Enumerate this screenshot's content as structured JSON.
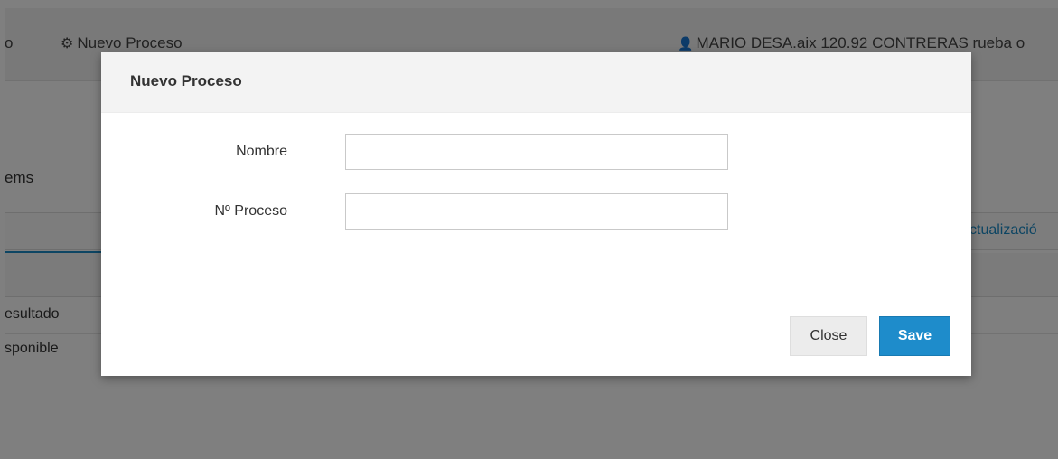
{
  "background": {
    "breadcrumb_prev": "o",
    "breadcrumb_current": "Nuevo Proceso",
    "user_text": "MARIO DESA.aix 120.92 CONTRERAS rueba o",
    "items_title": "ems",
    "tab_label": "ctualizació",
    "row1": "esultado",
    "row2": "sponible",
    "icons": {
      "cogs": "cogs-icon",
      "user": "user-icon"
    }
  },
  "modal": {
    "title": "Nuevo Proceso",
    "fields": [
      {
        "label": "Nombre",
        "value": "",
        "placeholder": ""
      },
      {
        "label": "Nº Proceso",
        "value": "",
        "placeholder": ""
      }
    ],
    "close_label": "Close",
    "save_label": "Save"
  },
  "colors": {
    "accent": "#1e8ccb",
    "overlay": "rgba(0,0,0,0.5)"
  }
}
